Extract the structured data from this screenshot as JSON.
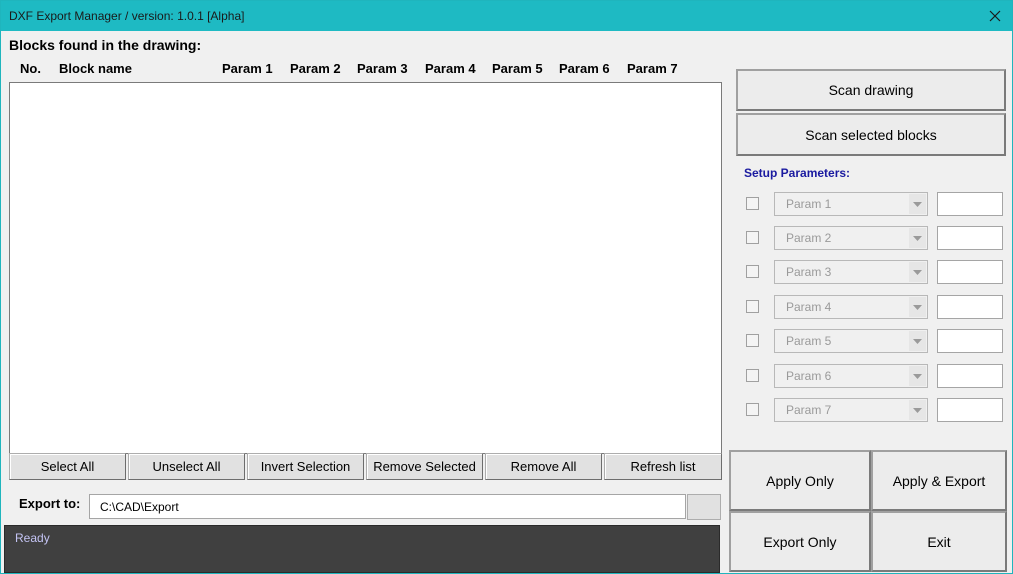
{
  "window": {
    "title": "DXF Export Manager  / version:  1.0.1 [Alpha]",
    "close_icon": "close-icon"
  },
  "blocks": {
    "heading": "Blocks found in the drawing:",
    "columns": [
      "No.",
      "Block name",
      "Param 1",
      "Param 2",
      "Param 3",
      "Param 4",
      "Param 5",
      "Param 6",
      "Param 7"
    ],
    "rows": []
  },
  "list_buttons": [
    "Select All",
    "Unselect All",
    "Invert Selection",
    "Remove Selected",
    "Remove All",
    "Refresh list"
  ],
  "export": {
    "label": "Export to:",
    "path": "C:\\CAD\\Export",
    "browse_label": ""
  },
  "status": {
    "text": "Ready"
  },
  "scan": {
    "drawing_label": "Scan drawing",
    "selected_label": "Scan selected blocks"
  },
  "setup": {
    "label": "Setup Parameters:",
    "params": [
      {
        "name": "Param 1",
        "checked": false,
        "value": ""
      },
      {
        "name": "Param 2",
        "checked": false,
        "value": ""
      },
      {
        "name": "Param 3",
        "checked": false,
        "value": ""
      },
      {
        "name": "Param 4",
        "checked": false,
        "value": ""
      },
      {
        "name": "Param 5",
        "checked": false,
        "value": ""
      },
      {
        "name": "Param 6",
        "checked": false,
        "value": ""
      },
      {
        "name": "Param 7",
        "checked": false,
        "value": ""
      }
    ]
  },
  "actions": {
    "apply_only": "Apply Only",
    "apply_export": "Apply & Export",
    "export_only": "Export Only",
    "exit": "Exit"
  },
  "colors": {
    "titlebar": "#1ebac3",
    "status_bg": "#404040",
    "status_text": "#c4c4f4",
    "setup_label": "#1a1aa0"
  }
}
